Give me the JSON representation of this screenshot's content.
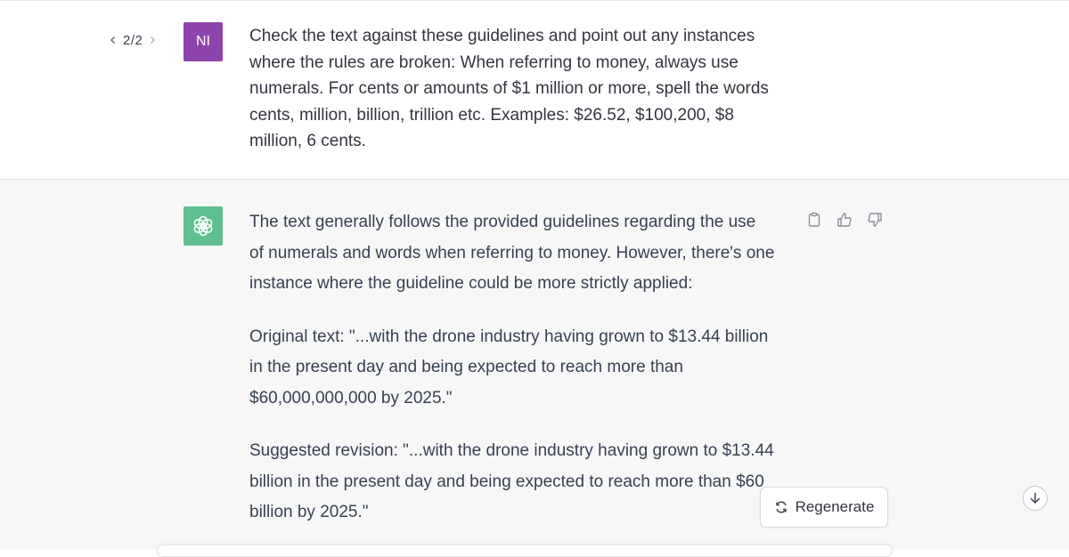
{
  "pager": {
    "current": "2",
    "separator": "/",
    "total": "2"
  },
  "user": {
    "avatar_initials": "NI",
    "avatar_color": "#8e44ad",
    "message_lines": [
      "Check the text against these guidelines and point out any instances",
      "where the rules are broken: When referring to money, always use",
      "numerals. For cents or amounts of $1 million or more, spell the words",
      "cents, million, billion, trillion etc. Examples: $26.52, $100,200, $8",
      "million, 6 cents."
    ]
  },
  "assistant": {
    "avatar_icon": "openai-logo-icon",
    "avatar_color": "#5fbf8f",
    "paragraphs": [
      [
        "The text generally follows the provided guidelines regarding the use",
        "of numerals and words when referring to money. However, there's one",
        "instance where the guideline could be more strictly applied:"
      ],
      [
        "Original text: \"...with the drone industry having grown to $13.44 billion",
        "in the present day and being expected to reach more than",
        "$60,000,000,000 by 2025.\""
      ],
      [
        "Suggested revision: \"...with the drone industry having grown to $13.44",
        "billion in the present day and being expected to reach more than $60",
        "billion by 2025.\""
      ]
    ]
  },
  "actions": {
    "copy": "clipboard-icon",
    "like": "thumbs-up-icon",
    "dislike": "thumbs-down-icon"
  },
  "regenerate": {
    "label": "Regenerate",
    "icon": "refresh-icon"
  },
  "scroll": {
    "icon": "arrow-down-icon"
  }
}
